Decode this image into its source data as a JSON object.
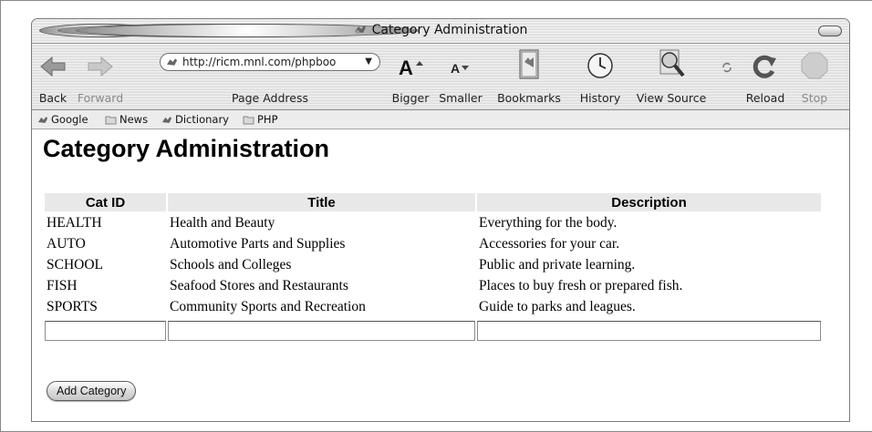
{
  "window": {
    "title": "Category Administration"
  },
  "toolbar": {
    "back_label": "Back",
    "forward_label": "Forward",
    "address_label": "Page Address",
    "url": "http://ricm.mnl.com/phpboo",
    "bigger_label": "Bigger",
    "smaller_label": "Smaller",
    "bookmarks_label": "Bookmarks",
    "history_label": "History",
    "view_source_label": "View Source",
    "reload_label": "Reload",
    "stop_label": "Stop"
  },
  "bookmarks_bar": {
    "items": [
      "Google",
      "News",
      "Dictionary",
      "PHP"
    ]
  },
  "page": {
    "heading": "Category Administration",
    "columns": [
      "Cat ID",
      "Title",
      "Description"
    ],
    "rows": [
      [
        "HEALTH",
        "Health and Beauty",
        "Everything for the body."
      ],
      [
        "AUTO",
        "Automotive Parts and Supplies",
        "Accessories for your car."
      ],
      [
        "SCHOOL",
        "Schools and Colleges",
        "Public and private learning."
      ],
      [
        "FISH",
        "Seafood Stores and Restaurants",
        "Places to buy fresh or prepared fish."
      ],
      [
        "SPORTS",
        "Community Sports and Recreation",
        "Guide to parks and leagues."
      ]
    ],
    "inputs": {
      "cat_id": "",
      "title": "",
      "description": ""
    },
    "add_button_label": "Add Category"
  },
  "icons": {
    "back": "back-arrow-icon",
    "forward": "forward-arrow-icon",
    "bigger": "text-bigger-icon",
    "smaller": "text-smaller-icon",
    "bookmarks": "bookmark-book-icon",
    "history": "clock-icon",
    "view_source": "magnifier-icon",
    "reload": "reload-icon",
    "stop": "stop-octagon-icon"
  }
}
